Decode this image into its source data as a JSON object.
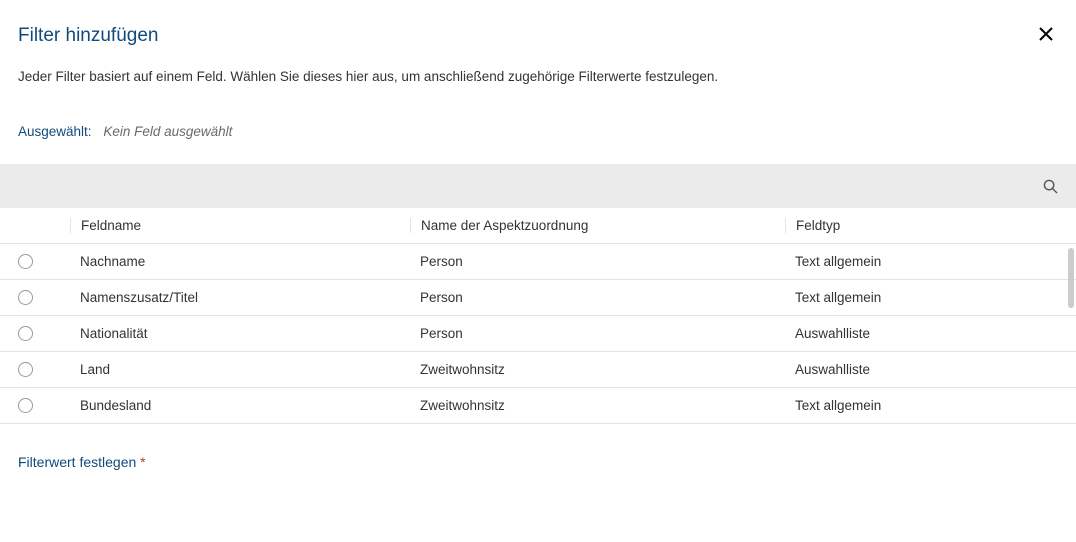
{
  "dialog": {
    "title": "Filter hinzufügen",
    "description": "Jeder Filter basiert auf einem Feld. Wählen Sie dieses hier aus, um anschließend zugehörige Filterwerte festzulegen."
  },
  "selection": {
    "label": "Ausgewählt:",
    "value": "Kein Feld ausgewählt"
  },
  "table": {
    "headers": {
      "name": "Feldname",
      "aspect": "Name der Aspektzuordnung",
      "type": "Feldtyp"
    },
    "rows": [
      {
        "name": "Nachname",
        "aspect": "Person",
        "type": "Text allgemein"
      },
      {
        "name": "Namenszusatz/Titel",
        "aspect": "Person",
        "type": "Text allgemein"
      },
      {
        "name": "Nationalität",
        "aspect": "Person",
        "type": "Auswahlliste"
      },
      {
        "name": "Land",
        "aspect": "Zweitwohnsitz",
        "type": "Auswahlliste"
      },
      {
        "name": "Bundesland",
        "aspect": "Zweitwohnsitz",
        "type": "Text allgemein"
      }
    ]
  },
  "section": {
    "title": "Filterwert festlegen",
    "required": "*"
  }
}
